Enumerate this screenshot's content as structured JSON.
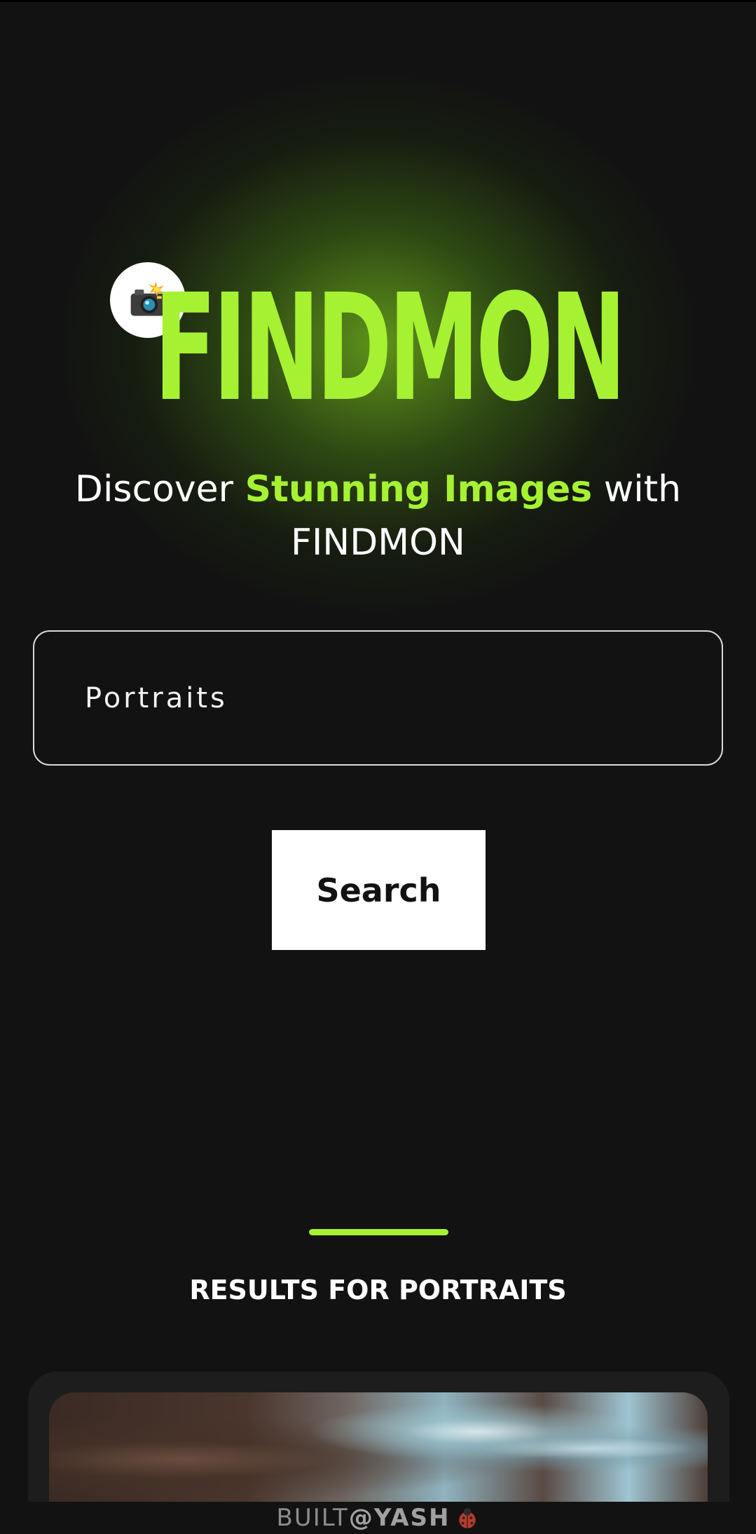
{
  "brand": {
    "name": "FINDMON",
    "icon": "camera-flash-icon",
    "accent_color": "#a6f232"
  },
  "tagline": {
    "prefix": "Discover ",
    "highlight": "Stunning Images",
    "suffix": " with FINDMON"
  },
  "search": {
    "value": "Portraits",
    "button_label": "Search"
  },
  "results": {
    "title": "RESULTS FOR PORTRAITS"
  },
  "footer": {
    "built": "BUILT",
    "author": "@YASH",
    "icon": "ladybug-icon"
  }
}
